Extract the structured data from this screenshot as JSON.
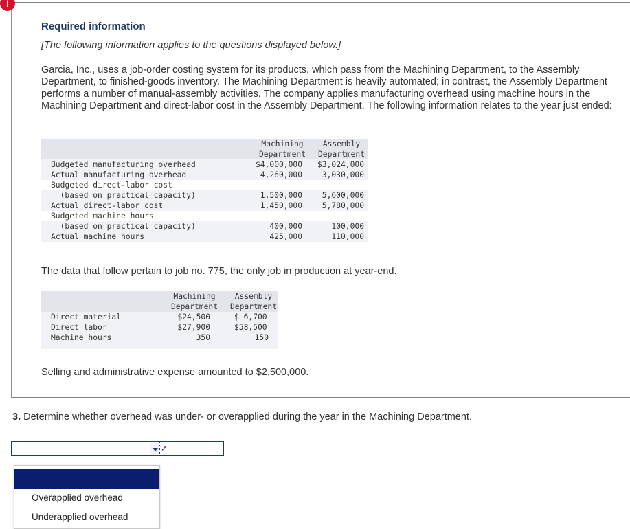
{
  "alert_badge": "!",
  "heading": "Required information",
  "note": "[The following information applies to the questions displayed below.]",
  "intro": "Garcia, Inc., uses a job-order costing system for its products, which pass from the Machining Department, to the Assembly Department, to finished-goods inventory. The Machining Department is heavily automated; in contrast, the Assembly Department performs a number of manual-assembly activities. The company applies manufacturing overhead using machine hours in the Machining Department and direct-labor cost in the Assembly Department. The following information relates to the year just ended:",
  "table1": {
    "col1_header": [
      "Machining",
      "Department"
    ],
    "col2_header": [
      "Assembly",
      "Department"
    ],
    "rows": [
      {
        "label": "Budgeted manufacturing overhead",
        "v1": "$4,000,000",
        "v2": "$3,024,000"
      },
      {
        "label": "Actual manufacturing overhead",
        "v1": "4,260,000",
        "v2": "3,030,000"
      },
      {
        "label": "Budgeted direct-labor cost",
        "v1": "",
        "v2": ""
      },
      {
        "label": "  (based on practical capacity)",
        "v1": "1,500,000",
        "v2": "5,600,000"
      },
      {
        "label": "Actual direct-labor cost",
        "v1": "1,450,000",
        "v2": "5,780,000"
      },
      {
        "label": "Budgeted machine hours",
        "v1": "",
        "v2": ""
      },
      {
        "label": "  (based on practical capacity)",
        "v1": "400,000",
        "v2": "100,000"
      },
      {
        "label": "Actual machine hours",
        "v1": "425,000",
        "v2": "110,000"
      }
    ]
  },
  "job_text": "The data that follow pertain to job no. 775, the only job in production at year-end.",
  "table2": {
    "col1_header": [
      "Machining",
      "Department"
    ],
    "col2_header": [
      "Assembly",
      "Department"
    ],
    "rows": [
      {
        "label": "Direct material",
        "v1": "$24,500",
        "v2": "$ 6,700"
      },
      {
        "label": "Direct labor",
        "v1": "$27,900",
        "v2": "$58,500"
      },
      {
        "label": "Machine hours",
        "v1": "350",
        "v2": "150"
      }
    ]
  },
  "selling_text": "Selling and administrative expense amounted to $2,500,000.",
  "question": {
    "number": "3.",
    "text": " Determine whether overhead was under- or overapplied during the year in the Machining Department."
  },
  "answer": {
    "selected_value": "",
    "options": [
      "",
      "Overapplied overhead",
      "Underapplied overhead"
    ]
  },
  "colors": {
    "badge": "#d6122c",
    "heading": "#1f3a5f",
    "highlight": "#0b1e6e"
  }
}
